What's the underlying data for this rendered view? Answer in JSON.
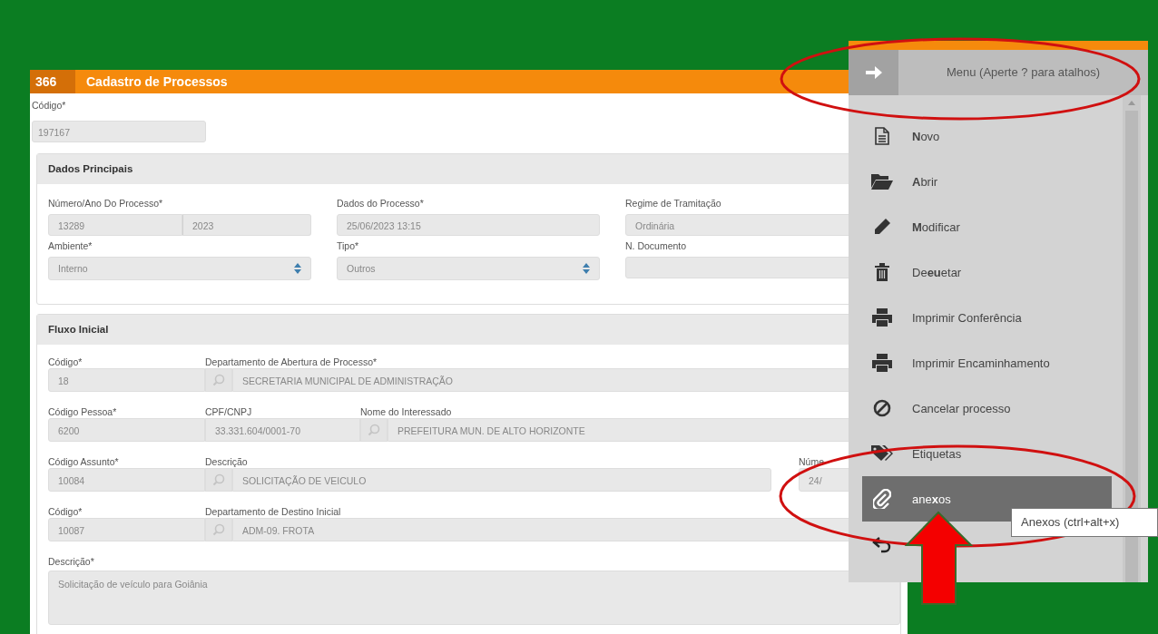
{
  "form": {
    "number": "366",
    "title": "Cadastro de Processos"
  },
  "code_field": {
    "label": "Código*",
    "value": "197167"
  },
  "main_section": {
    "title": "Dados Principais",
    "rows": [
      [
        {
          "kind": "split",
          "label": "Número/Ano Do Processo*",
          "values": [
            "13289",
            "2023"
          ]
        },
        {
          "kind": "text",
          "label": "Dados do Processo*",
          "value": "25/06/2023 13:15"
        },
        {
          "kind": "text",
          "label": "Regime de Tramitação",
          "value": "Ordinária"
        }
      ],
      [
        {
          "kind": "select",
          "label": "Ambiente*",
          "value": "Interno"
        },
        {
          "kind": "select",
          "label": "Tipo*",
          "value": "Outros"
        },
        {
          "kind": "text",
          "label": "N. Documento"
        }
      ]
    ]
  },
  "flow_section": {
    "title": "Fluxo Inicial",
    "rows": [
      [
        {
          "kind": "code",
          "label": "Código*",
          "value": "18"
        },
        {
          "kind": "lookup",
          "label": "Departamento de Abertura de Processo*",
          "value": "SECRETARIA MUNICIPAL DE ADMINISTRAÇÃO"
        }
      ],
      [
        {
          "kind": "code",
          "label": "Código Pessoa*",
          "value": "6200"
        },
        {
          "kind": "document",
          "label": "CPF/CNPJ",
          "value": "33.331.604/0001-70"
        },
        {
          "kind": "lookup",
          "label": "Nome do Interessado",
          "value": "PREFEITURA MUN. DE ALTO HORIZONTE"
        }
      ],
      [
        {
          "kind": "code",
          "label": "Código Assunto*",
          "value": "10084"
        },
        {
          "kind": "lookup",
          "label": "Descrição",
          "value": "SOLICITAÇÃO DE VEICULO"
        },
        {
          "kind": "date",
          "label": "Núme",
          "value": "24/"
        }
      ],
      [
        {
          "kind": "code",
          "label": "Código*",
          "value": "10087"
        },
        {
          "kind": "lookup",
          "label": "Departamento de Destino Inicial",
          "value": "ADM-09. FROTA"
        }
      ]
    ],
    "description": {
      "label": "Descrição*",
      "value": "Solicitação de veículo para Goiânia"
    }
  },
  "menu": {
    "title": "Menu (Aperte ? para atalhos)",
    "items": [
      {
        "label": "**N**ovo",
        "selected": false
      },
      {
        "label": "**A**brir",
        "selected": false
      },
      {
        "label": "**M**odificar",
        "selected": false
      },
      {
        "label": "De**eu**etar",
        "selected": false
      },
      {
        "label": "Imprimir Conferência",
        "selected": false
      },
      {
        "label": "Imprimir Encaminhamento",
        "selected": false
      },
      {
        "label": "Cancelar processo",
        "selected": false
      },
      {
        "label": "Etiquetas",
        "selected": false
      },
      {
        "label": "ane**x**os",
        "selected": true
      },
      {
        "selected": false
      }
    ]
  },
  "tooltip": "Anexos (ctrl+alt+x)"
}
